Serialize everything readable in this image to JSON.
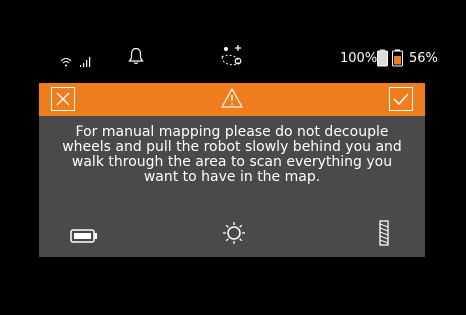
{
  "status_bar": {
    "icons": [
      "wifi-icon",
      "signal-icon",
      "bell-icon",
      "robot-icon",
      "robot-battery-icon"
    ],
    "phone_battery": "100%",
    "robot_battery": "56%"
  },
  "dialog": {
    "icons": [
      "close-icon",
      "warning-icon",
      "check-icon",
      "battery-icon",
      "light-icon",
      "brush-icon"
    ],
    "colors": {
      "header": "#ef7d1e",
      "body": "#4a4a4a",
      "battery_fill": "#ef7d1e"
    },
    "message": "For manual mapping please do not decouple wheels and pull the robot slowly behind you and walk through the area to scan everything you want to have in the map."
  }
}
